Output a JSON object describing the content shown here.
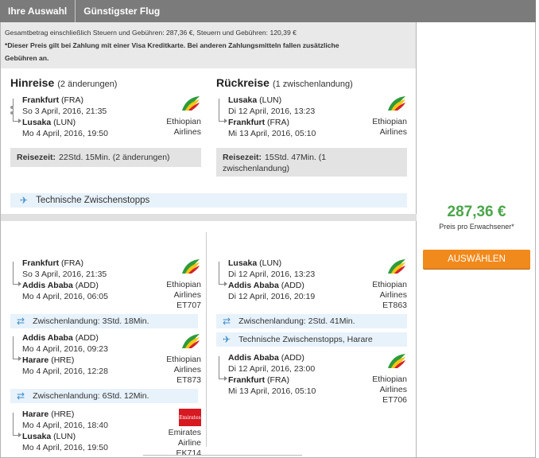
{
  "header": {
    "tab1": "Ihre Auswahl",
    "tab2": "Günstigster Flug"
  },
  "notice": {
    "line1": "Gesamtbetrag einschließlich Steuern und Gebühren: 287,36 €, Steuern und Gebühren: 120,39 €",
    "line2": "*Dieser Preis gilt bei Zahlung mit einer Visa Kreditkarte. Bei anderen Zahlungsmitteln fallen zusätzliche",
    "line3": "Gebühren an."
  },
  "outbound": {
    "title": "Hinreise",
    "note": "(2 änderungen)",
    "from_city": "Frankfurt",
    "from_code": "(FRA)",
    "from_time": "So 3 April, 2016, 21:35",
    "to_city": "Lusaka",
    "to_code": "(LUN)",
    "to_time": "Mo 4 April, 2016, 19:50",
    "airline1": "Ethiopian",
    "airline2": "Airlines",
    "reise_label": "Reisezeit:",
    "reise_value": "22Std. 15Min. (2 änderungen)"
  },
  "inbound": {
    "title": "Rückreise",
    "note": "(1 zwischenlandung)",
    "from_city": "Lusaka",
    "from_code": "(LUN)",
    "from_time": "Di 12 April, 2016, 13:23",
    "to_city": "Frankfurt",
    "to_code": "(FRA)",
    "to_time": "Mi 13 April, 2016, 05:10",
    "airline1": "Ethiopian",
    "airline2": "Airlines",
    "reise_label": "Reisezeit:",
    "reise_value1": "15Std. 47Min. (1",
    "reise_value2": "zwischenlandung)"
  },
  "tech_stops": "Technische Zwischenstopps",
  "out_detail": {
    "seg1": {
      "from_city": "Frankfurt",
      "from_code": "(FRA)",
      "from_time": "So 3 April, 2016, 21:35",
      "to_city": "Addis Ababa",
      "to_code": "(ADD)",
      "to_time": "Mo 4 April, 2016, 06:05",
      "a1": "Ethiopian",
      "a2": "Airlines",
      "flight": "ET707"
    },
    "stop1": "Zwischenlandung: 3Std. 18Min.",
    "seg2": {
      "from_city": "Addis Ababa",
      "from_code": "(ADD)",
      "from_time": "Mo 4 April, 2016, 09:23",
      "to_city": "Harare",
      "to_code": "(HRE)",
      "to_time": "Mo 4 April, 2016, 12:28",
      "a1": "Ethiopian",
      "a2": "Airlines",
      "flight": "ET873"
    },
    "stop2": "Zwischenlandung: 6Std. 12Min.",
    "seg3": {
      "from_city": "Harare",
      "from_code": "(HRE)",
      "from_time": "Mo 4 April, 2016, 18:40",
      "to_city": "Lusaka",
      "to_code": "(LUN)",
      "to_time": "Mo 4 April, 2016, 19:50",
      "a1": "Emirates",
      "a2": "Airline",
      "flight": "EK714",
      "logo_text": "Emirates"
    }
  },
  "in_detail": {
    "seg1": {
      "from_city": "Lusaka",
      "from_code": "(LUN)",
      "from_time": "Di 12 April, 2016, 13:23",
      "to_city": "Addis Ababa",
      "to_code": "(ADD)",
      "to_time": "Di 12 April, 2016, 20:19",
      "a1": "Ethiopian",
      "a2": "Airlines",
      "flight": "ET863"
    },
    "stop1": "Zwischenlandung: 2Std. 41Min.",
    "tech": "Technische Zwischenstopps, Harare",
    "seg2": {
      "from_city": "Addis Ababa",
      "from_code": "(ADD)",
      "from_time": "Di 12 April, 2016, 23:00",
      "to_city": "Frankfurt",
      "to_code": "(FRA)",
      "to_time": "Mi 13 April, 2016, 05:10",
      "a1": "Ethiopian",
      "a2": "Airlines",
      "flight": "ET706"
    }
  },
  "price": {
    "amount": "287,36 €",
    "per": "Preis pro Erwachsener*",
    "button": "AUSWÄHLEN"
  },
  "colors": {
    "header": "#7b7b7b",
    "price": "#4aa54a",
    "button": "#f18a1c",
    "info_bg": "#e8f2fb"
  }
}
